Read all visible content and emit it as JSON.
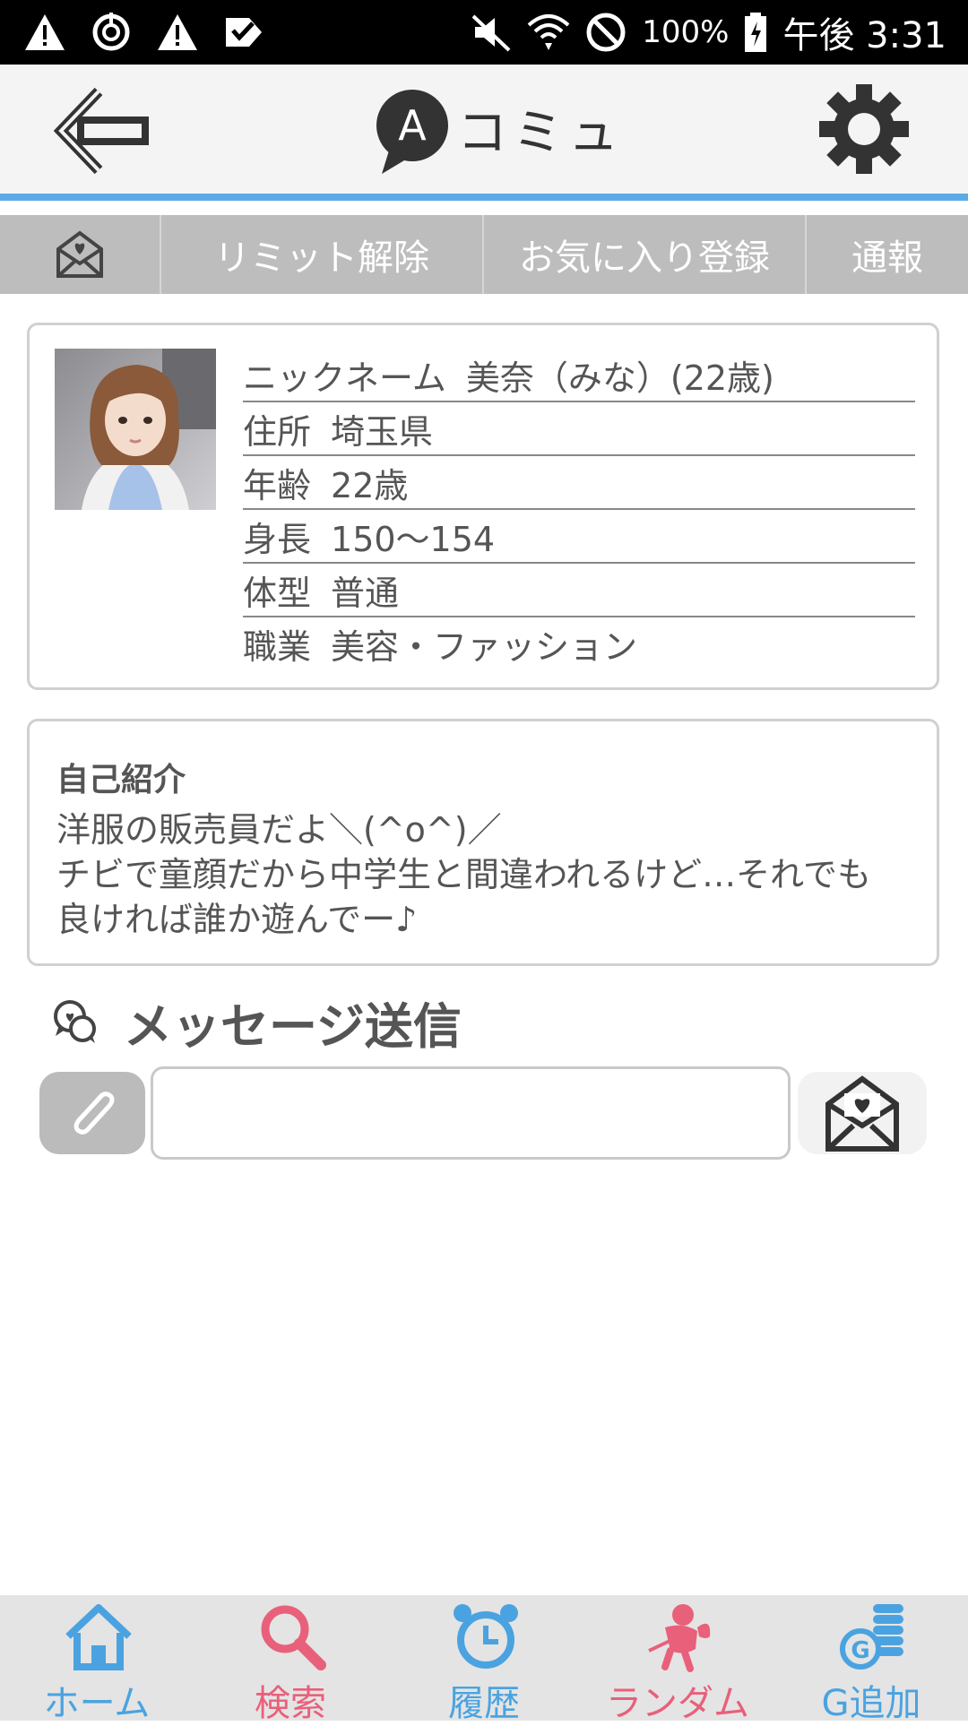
{
  "status_bar": {
    "battery": "100%",
    "time": "午後 3:31",
    "icons": [
      "warning-icon",
      "sync-icon",
      "warning-icon",
      "check-icon",
      "mute-icon",
      "wifi-icon",
      "block-icon",
      "battery-icon"
    ]
  },
  "header": {
    "logo_text": "コミュ",
    "logo_letter": "A"
  },
  "actions": {
    "limit": "リミット解除",
    "favorite": "お気に入り登録",
    "report": "通報"
  },
  "profile": {
    "rows": [
      {
        "key": "ニックネーム",
        "value": "美奈（みな）(22歳)"
      },
      {
        "key": "住所",
        "value": "埼玉県"
      },
      {
        "key": "年齢",
        "value": "22歳"
      },
      {
        "key": "身長",
        "value": "150～154"
      },
      {
        "key": "体型",
        "value": "普通"
      },
      {
        "key": "職業",
        "value": "美容・ファッション"
      }
    ]
  },
  "intro": {
    "title": "自己紹介",
    "lines": [
      "洋服の販売員だよ＼(^o^)／",
      "チビで童顔だから中学生と間違われるけど…それでも",
      "良ければ誰か遊んでー♪"
    ]
  },
  "message": {
    "title": "メッセージ送信",
    "input_value": ""
  },
  "nav": {
    "items": [
      {
        "label": "ホーム",
        "color": "#4aa3e0"
      },
      {
        "label": "検索",
        "color": "#e8607a"
      },
      {
        "label": "履歴",
        "color": "#4aa3e0"
      },
      {
        "label": "ランダム",
        "color": "#e8607a"
      },
      {
        "label": "G追加",
        "color": "#4aa3e0"
      }
    ]
  },
  "colors": {
    "accent_line": "#5aaae6",
    "action_bar": "#bdbdbd",
    "nav_blue": "#4aa3e0",
    "nav_pink": "#e8607a"
  }
}
